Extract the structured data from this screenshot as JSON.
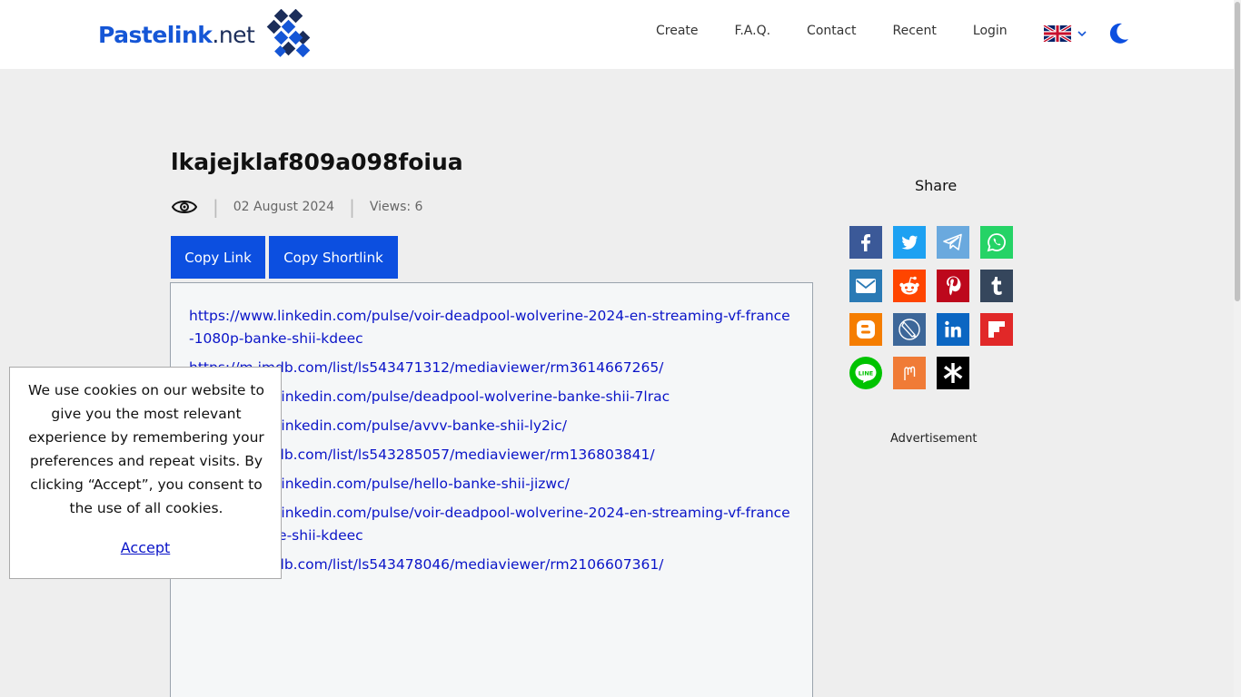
{
  "header": {
    "logo_text_main": "Pastelink",
    "logo_text_suffix": ".net",
    "nav": [
      "Create",
      "F.A.Q.",
      "Contact",
      "Recent",
      "Login"
    ],
    "language_icon": "uk-flag-icon",
    "theme_icon": "moon-icon"
  },
  "paste": {
    "title": "lkajejklaf809a098foiua",
    "date": "02 August 2024",
    "views": "Views: 6",
    "copy_link_label": "Copy Link",
    "copy_shortlink_label": "Copy Shortlink",
    "links": [
      "https://www.linkedin.com/pulse/voir-deadpool-wolverine-2024-en-streaming-vf-france-1080p-banke-shii-kdeec",
      "https://m.imdb.com/list/ls543471312/mediaviewer/rm3614667265/",
      "https://www.linkedin.com/pulse/deadpool-wolverine-banke-shii-7lrac",
      "https://www.linkedin.com/pulse/avvv-banke-shii-ly2ic/",
      "https://m.imdb.com/list/ls543285057/mediaviewer/rm136803841/",
      "https://www.linkedin.com/pulse/hello-banke-shii-jizwc/",
      "https://www.linkedin.com/pulse/voir-deadpool-wolverine-2024-en-streaming-vf-france-1080p-banke-shii-kdeec",
      "https://m.imdb.com/list/ls543478046/mediaviewer/rm2106607361/"
    ]
  },
  "share": {
    "title": "Share",
    "buttons": [
      {
        "icon": "facebook-icon",
        "color": "#3b5998"
      },
      {
        "icon": "twitter-icon",
        "color": "#1da1f2"
      },
      {
        "icon": "telegram-icon",
        "color": "#6aa9de"
      },
      {
        "icon": "whatsapp-icon",
        "color": "#25d366"
      },
      {
        "icon": "email-icon",
        "color": "#2a7ab5"
      },
      {
        "icon": "reddit-icon",
        "color": "#ff4500"
      },
      {
        "icon": "pinterest-icon",
        "color": "#bd081c"
      },
      {
        "icon": "tumblr-icon",
        "color": "#35465c"
      },
      {
        "icon": "blogger-icon",
        "color": "#f57d00"
      },
      {
        "icon": "livejournal-icon",
        "color": "#3d6799"
      },
      {
        "icon": "linkedin-icon",
        "color": "#0b66c2"
      },
      {
        "icon": "flipboard-icon",
        "color": "#e12828"
      },
      {
        "icon": "line-icon",
        "color": "#00c300"
      },
      {
        "icon": "mix-icon",
        "color": "#f07b36"
      },
      {
        "icon": "odnoklassniki-icon",
        "color": "#000000"
      }
    ],
    "advertisement_label": "Advertisement"
  },
  "cookie": {
    "text": "We use cookies on our website to give you the most relevant experience by remembering your preferences and repeat visits. By clicking “Accept”, you consent to the use of all cookies.",
    "accept_label": "Accept"
  },
  "colors": {
    "primary": "#0c4fe0",
    "link": "#0a14c8"
  }
}
